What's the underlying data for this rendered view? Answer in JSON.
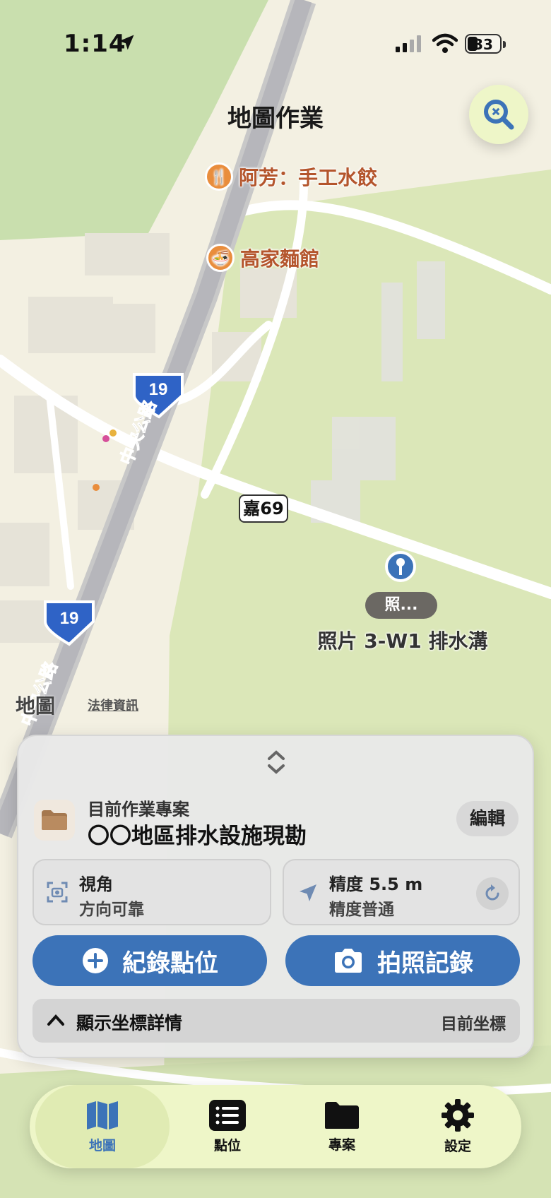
{
  "status_bar": {
    "time": "1:14",
    "battery": "33"
  },
  "header": {
    "title": "地圖作業"
  },
  "map": {
    "pois": [
      {
        "name": "阿芳：手工水餃"
      },
      {
        "name": "高家麵館"
      }
    ],
    "road_labels": {
      "central_road": "中央公路",
      "route_19": "19",
      "county_road": "嘉69"
    },
    "pin": {
      "tag": "照...",
      "title": "照片 3-W1 排水溝"
    },
    "attribution": {
      "maps": "地圖",
      "legal": "法律資訊"
    }
  },
  "sheet": {
    "project_label": "目前作業專案",
    "project_name": "〇〇地區排水設施現勘",
    "edit_label": "編輯",
    "heading_card": {
      "title": "視角",
      "value": "方向可靠"
    },
    "accuracy_card": {
      "title": "精度 5.5 m",
      "value": "精度普通"
    },
    "record_button": "紀錄點位",
    "photo_button": "拍照記錄",
    "coords_toggle": "顯示坐標詳情",
    "coords_value": "目前坐標"
  },
  "tabbar": {
    "tabs": [
      {
        "label": "地圖",
        "icon": "map-icon",
        "active": true
      },
      {
        "label": "點位",
        "icon": "list-icon",
        "active": false
      },
      {
        "label": "專案",
        "icon": "folder-icon",
        "active": false
      },
      {
        "label": "設定",
        "icon": "gear-icon",
        "active": false
      }
    ]
  },
  "colors": {
    "accent": "#3c73b8",
    "tab_bg": "#eef6c8",
    "poi": "#e98d3c"
  }
}
